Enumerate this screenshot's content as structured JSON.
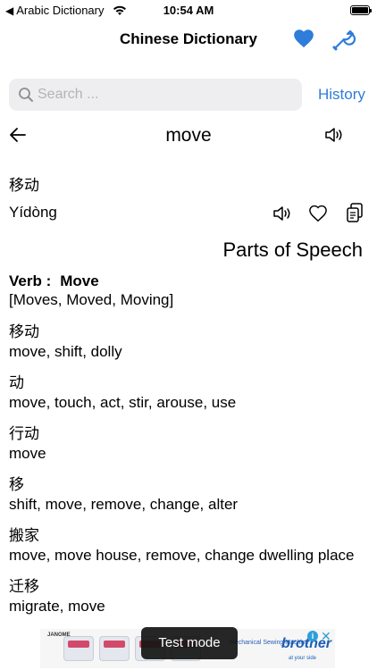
{
  "status_bar": {
    "back_app": "Arabic Dictionary",
    "time": "10:54 AM",
    "back_chevron_icon": "chevron-left-icon",
    "wifi_icon": "wifi-icon",
    "battery_icon": "battery-icon"
  },
  "nav": {
    "title": "Chinese Dictionary",
    "favorite_icon": "heart-filled-icon",
    "settings_icon": "wrench-icon",
    "accent_color": "#2e7dd9"
  },
  "search": {
    "placeholder": "Search ...",
    "value": "",
    "history_label": "History"
  },
  "word": {
    "title": "move",
    "hanzi": "移动",
    "pinyin": "Yídòng"
  },
  "parts_heading": "Parts of Speech",
  "verb": {
    "label": "Verb :",
    "word": "Move",
    "forms": "[Moves, Moved, Moving]"
  },
  "entries": [
    {
      "hanzi": "移动",
      "meaning": "move, shift, dolly"
    },
    {
      "hanzi": "动",
      "meaning": "move, touch, act, stir, arouse, use"
    },
    {
      "hanzi": "行动",
      "meaning": "move"
    },
    {
      "hanzi": "移",
      "meaning": "shift, move, remove, change, alter"
    },
    {
      "hanzi": "搬家",
      "meaning": "move, move house, remove, change dwelling place"
    },
    {
      "hanzi": "迁移",
      "meaning": "migrate, move"
    }
  ],
  "ad": {
    "brand_left": "JANOME",
    "text": "Mechanical Sewing Machine",
    "logo": "brother",
    "tagline": "at your side",
    "info": "i",
    "close": "✕"
  },
  "test_mode": "Test mode"
}
